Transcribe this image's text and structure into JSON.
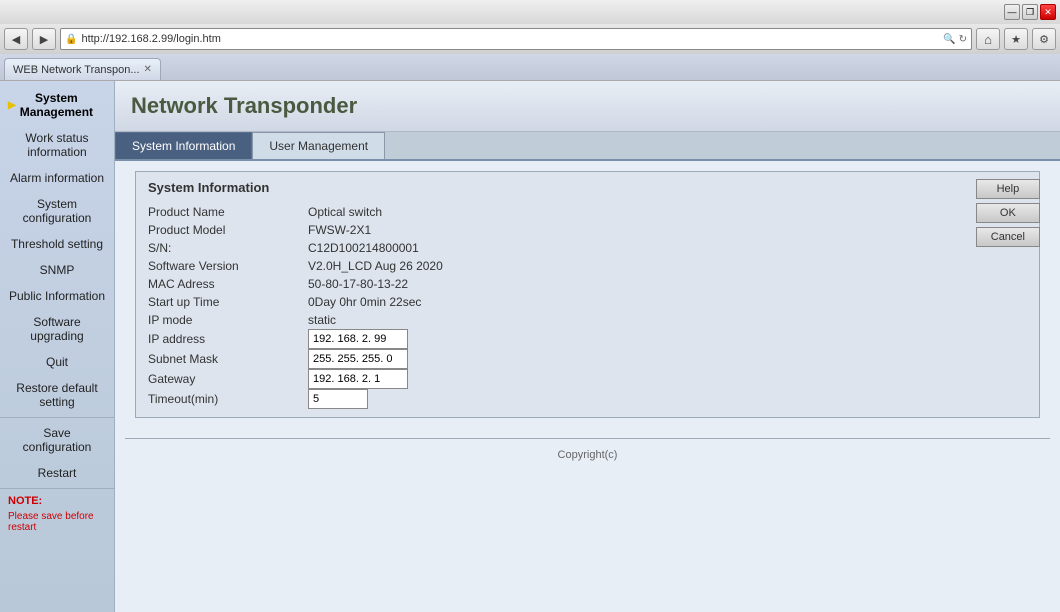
{
  "browser": {
    "url": "http://192.168.2.99/login.htm",
    "tab_title": "WEB Network Transpon...",
    "back_icon": "◀",
    "forward_icon": "▶",
    "refresh_icon": "↻",
    "search_icon": "🔍",
    "home_icon": "⌂",
    "star_icon": "★",
    "settings_icon": "⚙",
    "minimize": "—",
    "restore": "❐",
    "close": "✕",
    "lock_icon": "🔒"
  },
  "page": {
    "title": "Network Transponder"
  },
  "tabs": {
    "system_information": "System Information",
    "user_management": "User Management"
  },
  "sidebar": {
    "items": [
      {
        "id": "system-management",
        "label": "System\nManagement",
        "active_arrow": true
      },
      {
        "id": "work-status",
        "label": "Work status information"
      },
      {
        "id": "alarm-information",
        "label": "Alarm information"
      },
      {
        "id": "system-configuration",
        "label": "System configuration"
      },
      {
        "id": "threshold-setting",
        "label": "Threshold setting"
      },
      {
        "id": "snmp",
        "label": "SNMP"
      },
      {
        "id": "public-information",
        "label": "Public Information"
      },
      {
        "id": "software-upgrading",
        "label": "Software upgrading"
      },
      {
        "id": "quit",
        "label": "Quit"
      },
      {
        "id": "restore-default",
        "label": "Restore default setting"
      }
    ],
    "divider_items": [
      {
        "id": "save-configuration",
        "label": "Save configuration"
      },
      {
        "id": "restart",
        "label": "Restart"
      }
    ],
    "note_label": "NOTE:",
    "note_text": "Please save before restart"
  },
  "system_info": {
    "panel_title": "System Information",
    "fields": [
      {
        "label": "Product Name",
        "value": "Optical switch",
        "type": "text"
      },
      {
        "label": "Product Model",
        "value": "FWSW-2X1",
        "type": "text"
      },
      {
        "label": "S/N:",
        "value": "C12D100214800001",
        "type": "text"
      },
      {
        "label": "Software Version",
        "value": "V2.0H_LCD Aug 26 2020",
        "type": "text"
      },
      {
        "label": "MAC Adress",
        "value": "50-80-17-80-13-22",
        "type": "text"
      },
      {
        "label": "Start up Time",
        "value": "0Day 0hr 0min 22sec",
        "type": "text"
      },
      {
        "label": "IP mode",
        "value": "static",
        "type": "text"
      },
      {
        "label": "IP address",
        "value": "192. 168. 2. 99",
        "type": "input"
      },
      {
        "label": "Subnet Mask",
        "value": "255. 255. 255. 0",
        "type": "input"
      },
      {
        "label": "Gateway",
        "value": "192. 168. 2. 1",
        "type": "input"
      },
      {
        "label": "Timeout(min)",
        "value": "5",
        "type": "input"
      }
    ],
    "buttons": [
      {
        "id": "help",
        "label": "Help"
      },
      {
        "id": "ok",
        "label": "OK"
      },
      {
        "id": "cancel",
        "label": "Cancel"
      }
    ],
    "copyright": "Copyright(c)"
  }
}
